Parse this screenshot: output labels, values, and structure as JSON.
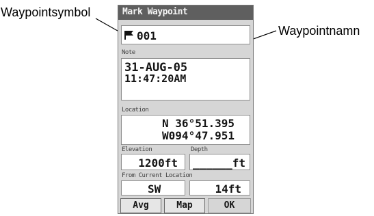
{
  "callouts": {
    "symbol": "Waypointsymbol",
    "name": "Waypointnamn"
  },
  "screen": {
    "title": "Mark Waypoint",
    "waypoint": {
      "symbol_icon": "flag-icon",
      "name": "001"
    },
    "note": {
      "label": "Note",
      "date": "31-AUG-05",
      "time": "11:47:20AM"
    },
    "location": {
      "label": "Location",
      "lat": "N  36°51.395",
      "lon": "W094°47.951"
    },
    "elevation": {
      "label": "Elevation",
      "value": "1200ft"
    },
    "depth": {
      "label": "Depth",
      "value": "______ft"
    },
    "bearing_distance": {
      "label": "From Current Location",
      "bearing": "SW",
      "distance": "14ft"
    },
    "buttons": {
      "avg": "Avg",
      "map": "Map",
      "ok": "OK"
    }
  },
  "colors": {
    "titlebar": "#5f5f5f",
    "panel": "#d6d6d6",
    "field": "#ffffff"
  }
}
